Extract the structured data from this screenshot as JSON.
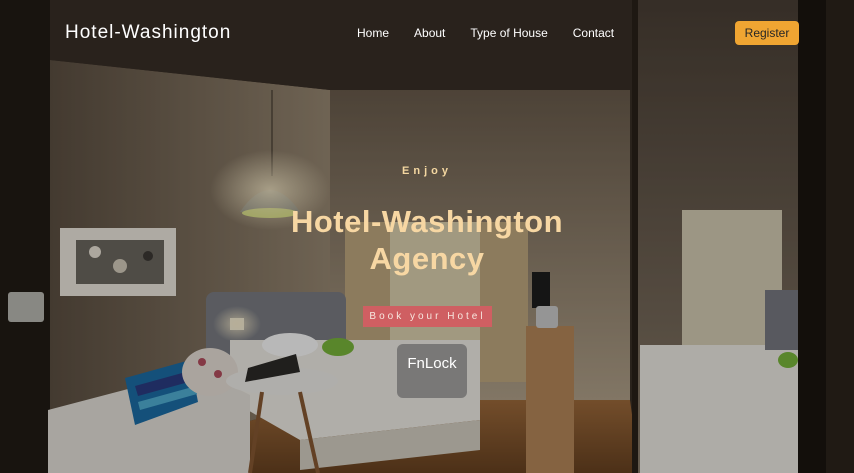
{
  "nav": {
    "brand": "Hotel-Washington",
    "links": [
      "Home",
      "About",
      "Type of House",
      "Contact"
    ],
    "register_label": "Register"
  },
  "hero": {
    "eyebrow": "Enjoy",
    "title_line1": "Hotel-Washington",
    "title_line2": "Agency",
    "cta_label": "Book your Hotel"
  },
  "overlay": {
    "fnlock_label": "FnLock"
  },
  "colors": {
    "accent": "#f0a532",
    "cta": "#cf5f62",
    "headline": "#f7d7a3"
  }
}
